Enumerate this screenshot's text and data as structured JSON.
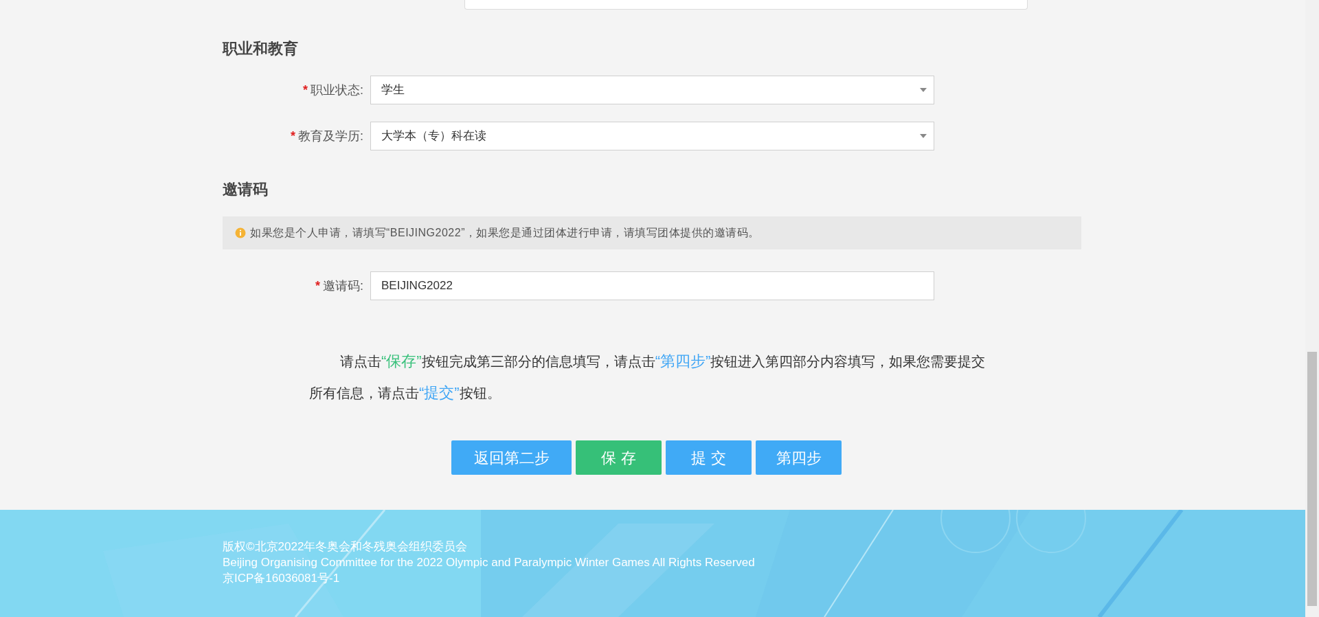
{
  "sections": [
    {
      "heading": "职业和教育",
      "fields": [
        {
          "kind": "select",
          "mark": "*",
          "label": "职业状态:",
          "value": "学生"
        },
        {
          "kind": "select",
          "mark": "*",
          "label": "教育及学历:",
          "value": "大学本（专）科在读"
        }
      ]
    },
    {
      "heading": "邀请码",
      "notice": "如果您是个人申请，请填写“BEIJING2022”，如果您是通过团体进行申请，请填写团体提供的邀请码。",
      "fields": [
        {
          "kind": "text",
          "mark": "*",
          "label": "邀请码:",
          "value": "BEIJING2022"
        }
      ]
    }
  ],
  "instruction": [
    {
      "kind": "plain",
      "text": "请点击"
    },
    {
      "kind": "green",
      "text": "“保存”"
    },
    {
      "kind": "plain",
      "text": "按钮完成第三部分的信息填写，请点击"
    },
    {
      "kind": "blue",
      "text": "“第四步”"
    },
    {
      "kind": "plain",
      "text": "按钮进入第四部分内容填写，如果您需要提交所有信息，请点击"
    },
    {
      "kind": "blue",
      "text": "“提交”"
    },
    {
      "kind": "plain",
      "text": "按钮。"
    }
  ],
  "buttons": [
    {
      "kind": "blue",
      "label": "返回第二步"
    },
    {
      "kind": "green",
      "label": "保 存"
    },
    {
      "kind": "blue",
      "label": "提 交"
    },
    {
      "kind": "blue",
      "label": "第四步"
    }
  ],
  "footer": [
    "版权©北京2022年冬奥会和冬残奥会组织委员会",
    "Beijing Organising Committee for the 2022 Olympic and Paralympic Winter Games All Rights Reserved",
    "京ICP备16036081号-1"
  ]
}
